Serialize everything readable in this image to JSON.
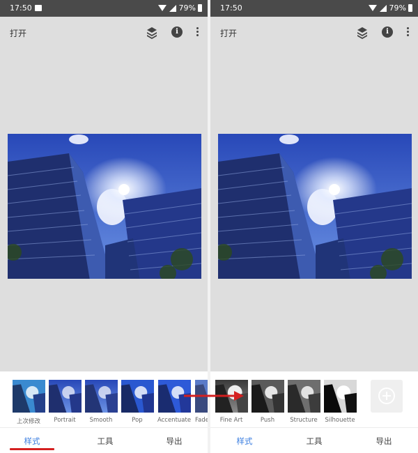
{
  "status_bar": {
    "time": "17:50",
    "battery": "79%"
  },
  "app_bar": {
    "open_label": "打开"
  },
  "filters_left": [
    {
      "label": "上次修改",
      "tone": "color"
    },
    {
      "label": "Portrait",
      "tone": "color"
    },
    {
      "label": "Smooth",
      "tone": "color"
    },
    {
      "label": "Pop",
      "tone": "color"
    },
    {
      "label": "Accentuate",
      "tone": "color"
    },
    {
      "label": "Fade",
      "tone": "color"
    }
  ],
  "filters_right": [
    {
      "label": "Fine Art",
      "tone": "bw"
    },
    {
      "label": "Push",
      "tone": "bw"
    },
    {
      "label": "Structure",
      "tone": "bw"
    },
    {
      "label": "Silhouette",
      "tone": "bw"
    }
  ],
  "nav": {
    "styles": "样式",
    "tools": "工具",
    "export": "导出"
  },
  "colors": {
    "accent": "#3a7de0",
    "underline": "#d42020",
    "arrow": "#d42020",
    "status_bar": "#4a4a4a",
    "canvas_bg": "#dedede"
  },
  "icons": [
    "image-icon",
    "wifi-icon",
    "signal-icon",
    "battery-icon",
    "layers-icon",
    "info-icon",
    "more-vert-icon",
    "add-style-icon",
    "arrow-icon"
  ]
}
